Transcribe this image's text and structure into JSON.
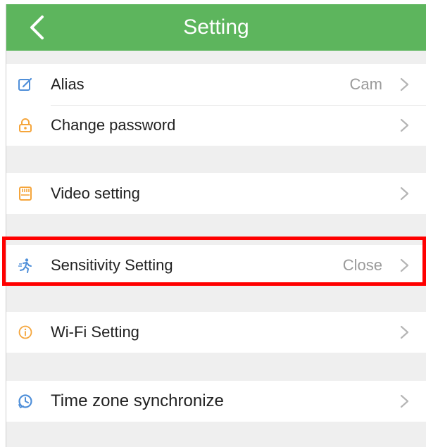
{
  "header": {
    "title": "Setting"
  },
  "rows": [
    {
      "label": "Alias",
      "value": "Cam",
      "icon": "edit-icon"
    },
    {
      "label": "Change password",
      "value": "",
      "icon": "lock-icon"
    },
    {
      "label": "Video setting",
      "value": "",
      "icon": "sd-card-icon"
    },
    {
      "label": "Sensitivity Setting",
      "value": "Close",
      "icon": "motion-person-icon"
    },
    {
      "label": "Wi-Fi Setting",
      "value": "",
      "icon": "info-icon"
    },
    {
      "label": "Time zone synchronize",
      "value": "",
      "icon": "clock-sync-icon"
    }
  ],
  "colors": {
    "header_bg": "#5db55d",
    "icon_orange": "#f5a53b",
    "icon_blue": "#4f8fd9",
    "highlight": "#ff0000"
  }
}
